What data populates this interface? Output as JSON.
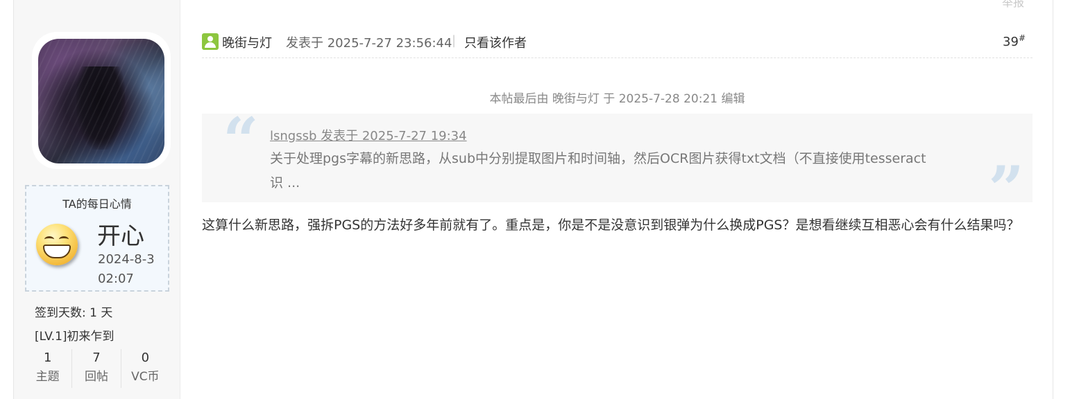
{
  "report": {
    "label": "举报"
  },
  "user": {
    "mood": {
      "title": "TA的每日心情",
      "name": "开心",
      "date": "2024-8-3",
      "time": "02:07"
    },
    "signin_days": "签到天数: 1 天",
    "level": "[LV.1]初来乍到",
    "stats": [
      {
        "value": "1",
        "label": "主题"
      },
      {
        "value": "7",
        "label": "回帖"
      },
      {
        "value": "0",
        "label": "VC币"
      }
    ]
  },
  "post": {
    "author": "晚街与灯",
    "posted_at": "发表于 2025-7-27 23:56:44",
    "separator": "|",
    "author_only": "只看该作者",
    "floor": "39",
    "floor_mark": "#",
    "edit_note": "本帖最后由 晚街与灯 于 2025-7-28 20:21 编辑",
    "quote": {
      "header": "lsngssb 发表于 2025-7-27 19:34",
      "body": "关于处理pgs字幕的新思路，从sub中分别提取图片和时间轴，然后OCR图片获得txt文档（不直接使用tesseract 识 ..."
    },
    "reply": "这算什么新思路，强拆PGS的方法好多年前就有了。重点是，你是不是没意识到银弹为什么换成PGS？是想看继续互相恶心会有什么结果吗？"
  },
  "colors": {
    "online_icon": "#8dc63f",
    "mood_box_border": "#c9d3dc",
    "quote_mark": "#d2e1ee"
  }
}
